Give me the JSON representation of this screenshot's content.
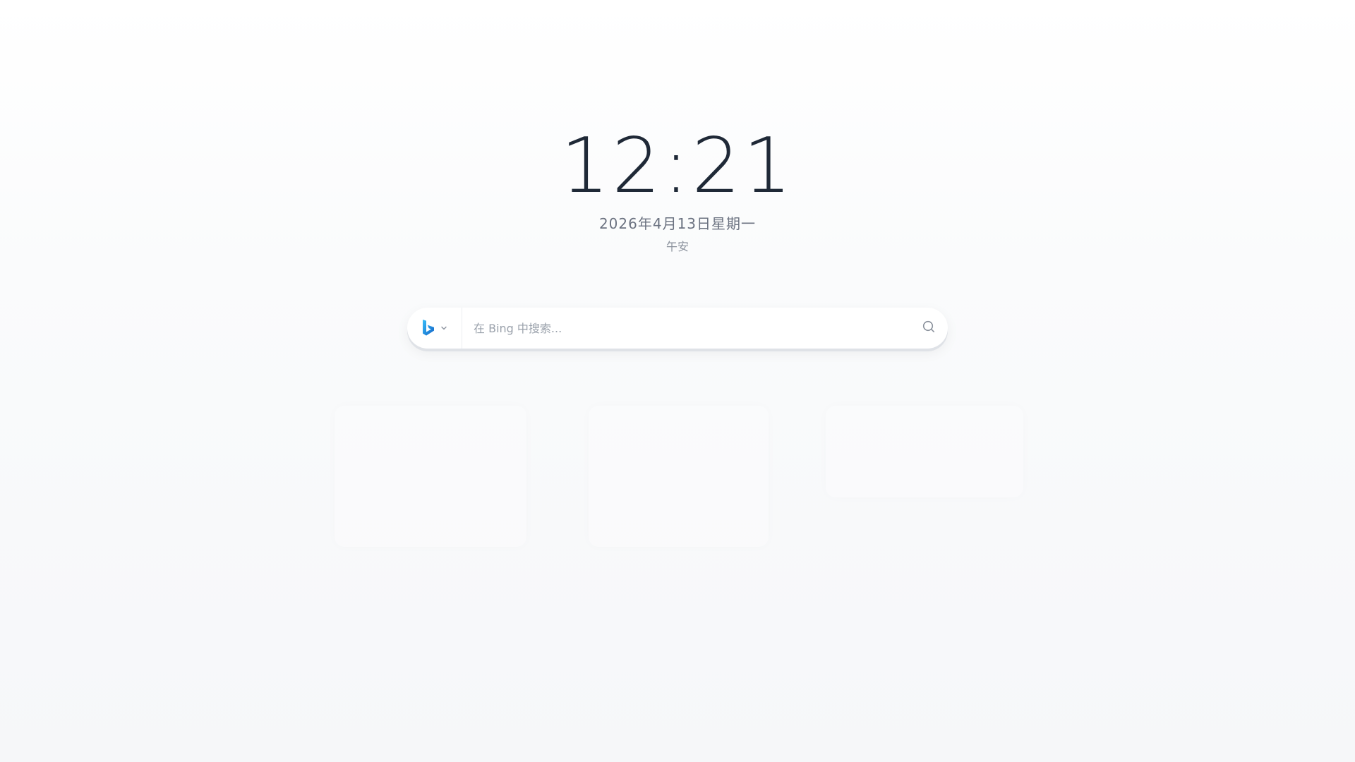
{
  "clock": {
    "time": "12:21",
    "date": "2026年4月13日星期一",
    "greeting": "午安"
  },
  "search": {
    "engine_icon": "bing-logo-icon",
    "dropdown_icon": "chevron-down-icon",
    "placeholder": "在 Bing 中搜索...",
    "value": "",
    "submit_icon": "search-icon"
  },
  "colors": {
    "text_primary": "#1f2937",
    "text_secondary": "#6b7280",
    "bing_blue": "#1b8ad4"
  }
}
